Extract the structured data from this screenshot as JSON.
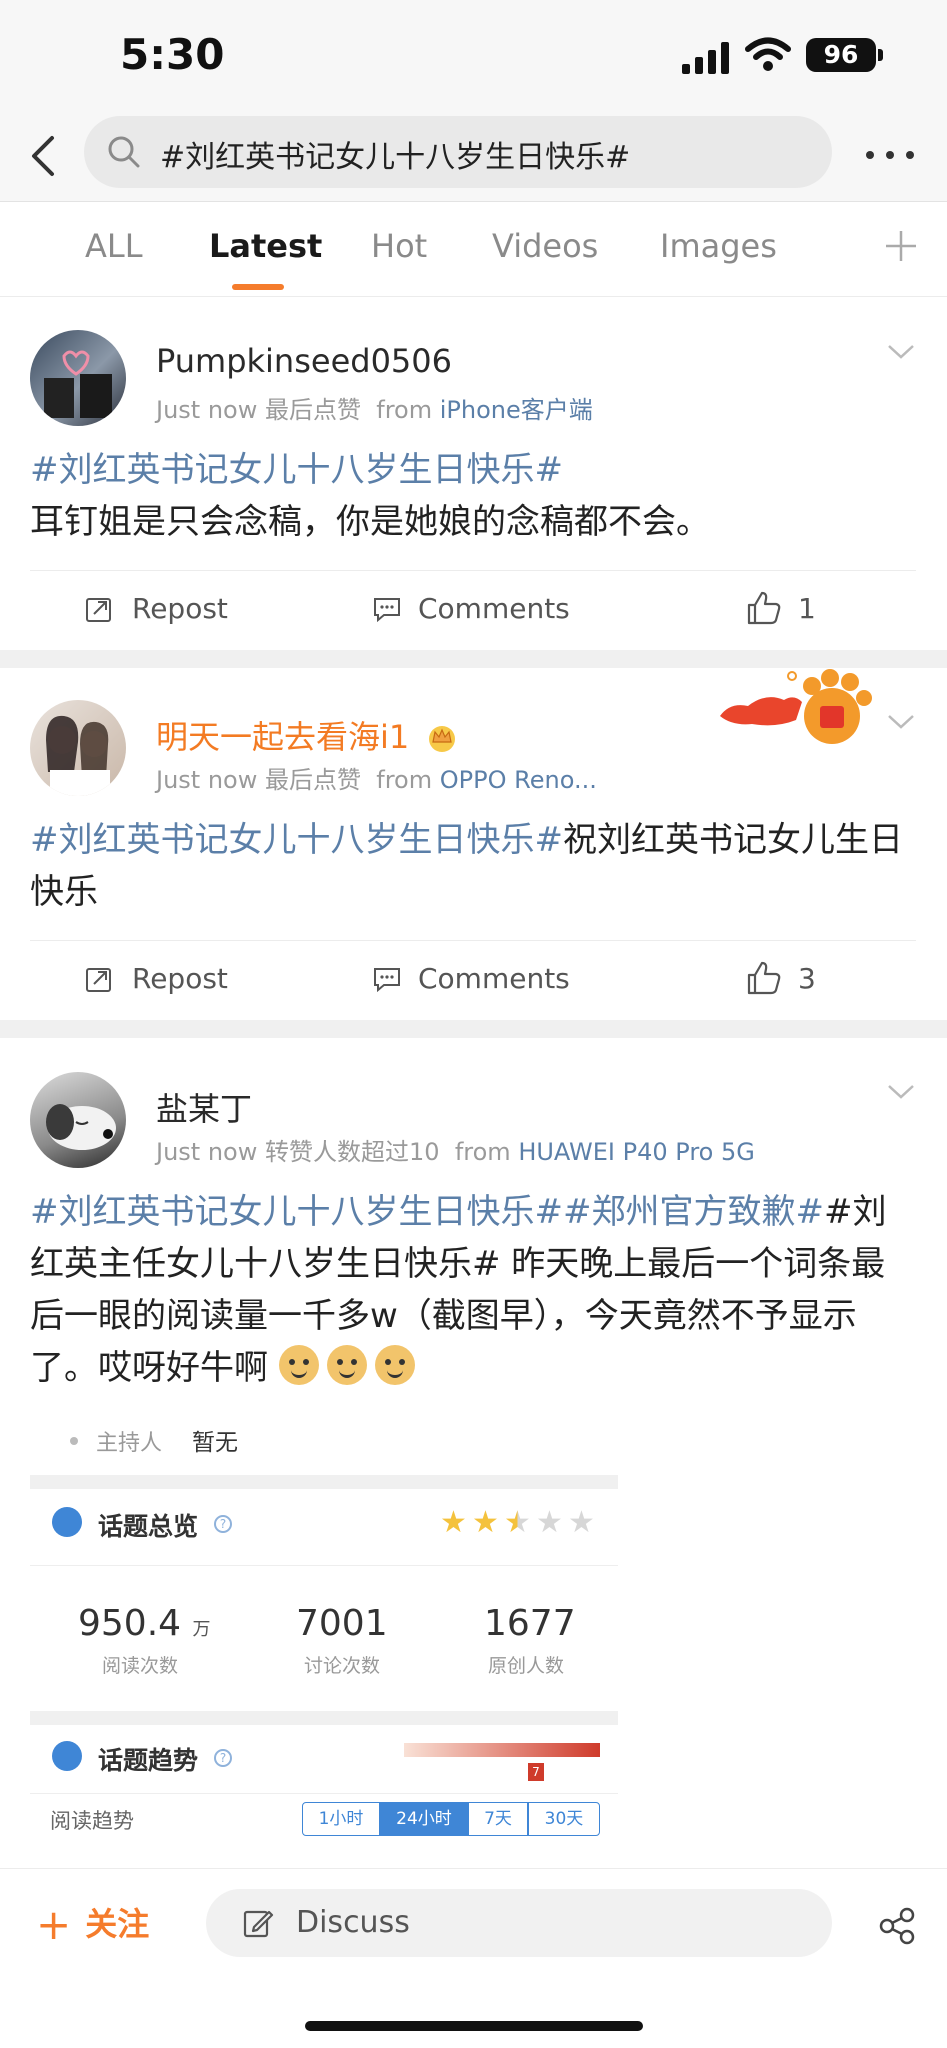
{
  "status_bar": {
    "time": "5:30",
    "battery": "96"
  },
  "search": {
    "query": "#刘红英书记女儿十八岁生日快乐#"
  },
  "tabs": [
    {
      "label": "ALL"
    },
    {
      "label": "Latest",
      "active": true
    },
    {
      "label": "Hot"
    },
    {
      "label": "Videos"
    },
    {
      "label": "Images"
    }
  ],
  "colors": {
    "accent": "#f57c2c",
    "topic_link": "#5b7fa8",
    "vip_name": "#f37b23"
  },
  "posts": [
    {
      "username": "Pumpkinseed0506",
      "time": "Just now",
      "tag": "最后点赞",
      "from_prefix": "from",
      "source": "iPhone客户端",
      "topic": "#刘红英书记女儿十八岁生日快乐#",
      "text": "耳钉姐是只会念稿，你是她娘的念稿都不会。",
      "repost": "Repost",
      "comments": "Comments",
      "likes": "1"
    },
    {
      "username": "明天一起去看海i1",
      "time": "Just now",
      "tag": "最后点赞",
      "from_prefix": "from",
      "source": "OPPO Reno...",
      "topic": "#刘红英书记女儿十八岁生日快乐#",
      "text": "祝刘红英书记女儿生日快乐",
      "repost": "Repost",
      "comments": "Comments",
      "likes": "3"
    },
    {
      "username": "盐某丁",
      "time": "Just now",
      "tag": "转赞人数超过10",
      "from_prefix": "from",
      "source": "HUAWEI P40 Pro 5G",
      "topic": "#刘红英书记女儿十八岁生日快乐#",
      "topic2": "#郑州官方致歉#",
      "text": "#刘红英主任女儿十八岁生日快乐# 昨天晚上最后一个词条最后一眼的阅读量一千多w（截图早），今天竟然不予显示了。哎呀好牛啊",
      "embed": {
        "host_label": "主持人",
        "host_value": "暂无",
        "overview_title": "话题总览",
        "rating_stars": 2.5,
        "stats": [
          {
            "value": "950.4",
            "unit": "万",
            "label": "阅读次数"
          },
          {
            "value": "7001",
            "unit": "",
            "label": "讨论次数"
          },
          {
            "value": "1677",
            "unit": "",
            "label": "原创人数"
          }
        ],
        "trend_title": "话题趋势",
        "trend_marker": "7",
        "read_trend_label": "阅读趋势",
        "ranges": [
          "1小时",
          "24小时",
          "7天",
          "30天"
        ],
        "selected_range": "24小时"
      }
    }
  ],
  "bottom_bar": {
    "follow": "关注",
    "discuss": "Discuss"
  }
}
